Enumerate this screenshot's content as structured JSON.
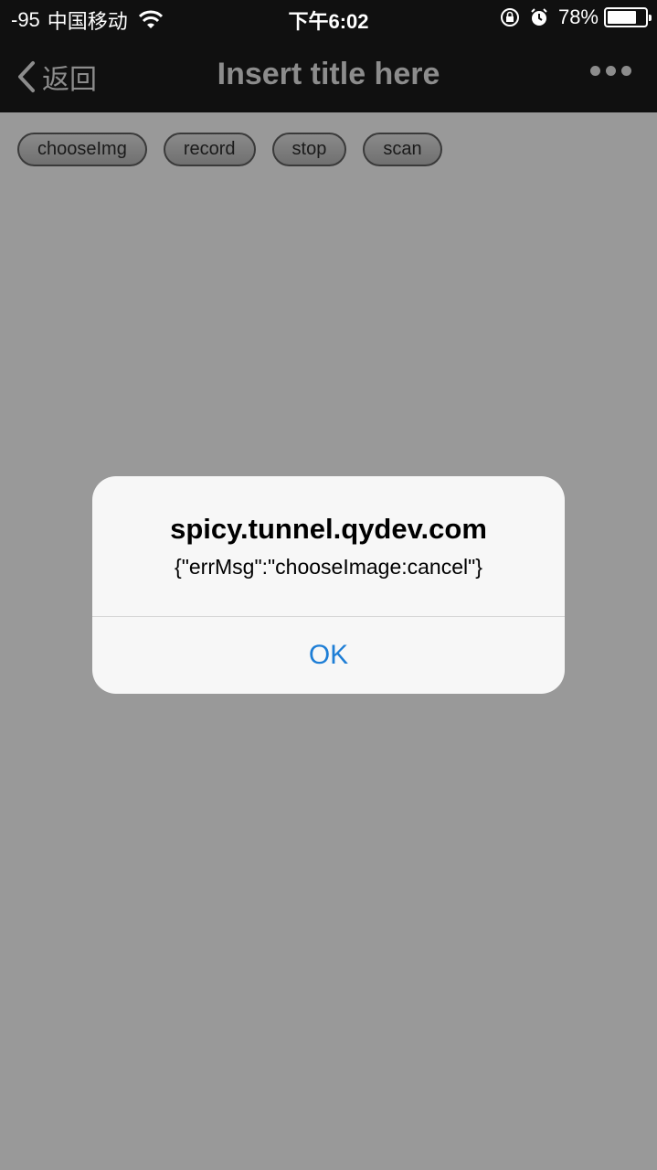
{
  "status_bar": {
    "signal": "-95",
    "carrier": "中国移动",
    "time": "下午6:02",
    "battery_percent": "78%",
    "battery_level": 0.78,
    "icons": [
      "wifi-icon",
      "rotation-lock-icon",
      "alarm-icon",
      "battery-icon"
    ]
  },
  "nav_bar": {
    "back_label": "返回",
    "title": "Insert title here",
    "icons": [
      "chevron-left-icon",
      "more-dots-icon"
    ]
  },
  "buttons": [
    "chooseImg",
    "record",
    "stop",
    "scan"
  ],
  "alert": {
    "title": "spicy.tunnel.qydev.com",
    "message": "{\"errMsg\":\"chooseImage:cancel\"}",
    "ok_label": "OK"
  },
  "colors": {
    "overlay_bg": "#999999",
    "topbar_bg": "#101010",
    "alert_bg": "#f7f7f7",
    "accent_link": "#1e7ed6"
  }
}
